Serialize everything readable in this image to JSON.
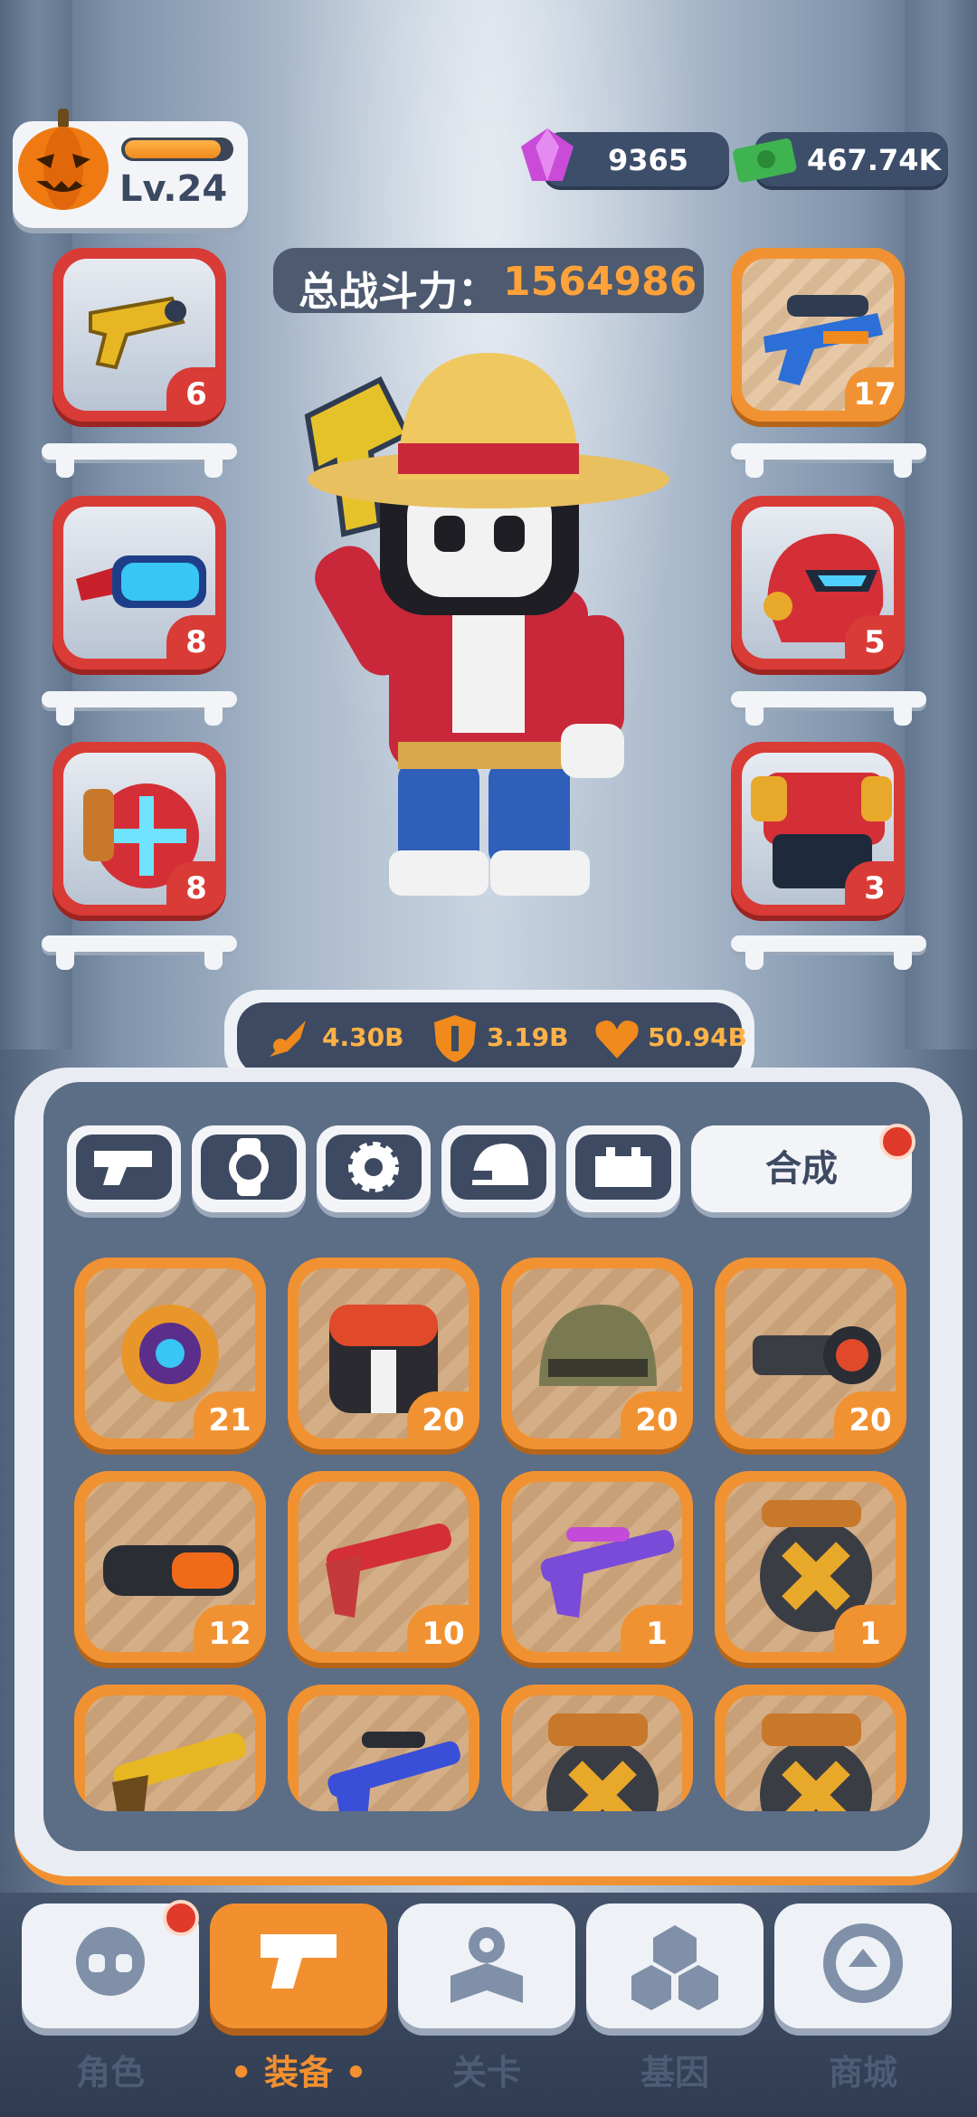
{
  "player": {
    "level": "Lv.24",
    "avatar_icon": "pumpkin-avatar-icon"
  },
  "currency": {
    "gems": "9365",
    "cash": "467.74K"
  },
  "power": {
    "label": "总战斗力：",
    "value": "1564986"
  },
  "left_slots": [
    {
      "name": "golden-pistol",
      "count": "6"
    },
    {
      "name": "cyber-goggles",
      "count": "8"
    },
    {
      "name": "ammo-drum",
      "count": "8"
    }
  ],
  "right_slots": [
    {
      "name": "scoped-blaster",
      "count": "17"
    },
    {
      "name": "red-helmet",
      "count": "5"
    },
    {
      "name": "red-armor",
      "count": "3"
    }
  ],
  "stats": {
    "attack": "4.30B",
    "defense": "3.19B",
    "health": "50.94B"
  },
  "tabs": [
    "weapon",
    "watch",
    "gear",
    "helmet",
    "armor"
  ],
  "merge_label": "合成",
  "inventory": [
    {
      "name": "purple-watch",
      "count": "21"
    },
    {
      "name": "mr-bones-vest",
      "count": "20"
    },
    {
      "name": "army-helmet",
      "count": "20"
    },
    {
      "name": "scope",
      "count": "20"
    },
    {
      "name": "orange-goggles",
      "count": "12"
    },
    {
      "name": "red-shotgun",
      "count": "10"
    },
    {
      "name": "purple-rifle",
      "count": "1"
    },
    {
      "name": "ammo-drum-dark",
      "count": "1"
    },
    {
      "name": "golden-shotgun",
      "count": ""
    },
    {
      "name": "blue-sniper",
      "count": ""
    },
    {
      "name": "ammo-drum-2",
      "count": ""
    },
    {
      "name": "ammo-drum-3",
      "count": ""
    }
  ],
  "nav": [
    {
      "label": "角色",
      "icon": "skull-icon"
    },
    {
      "label": "装备",
      "icon": "gun-icon"
    },
    {
      "label": "关卡",
      "icon": "map-icon"
    },
    {
      "label": "基因",
      "icon": "hexagon-icon"
    },
    {
      "label": "商城",
      "icon": "shop-icon"
    }
  ],
  "colors": {
    "accent": "#f19232",
    "slot_red": "#d93b36",
    "panel": "#5c6d86"
  }
}
